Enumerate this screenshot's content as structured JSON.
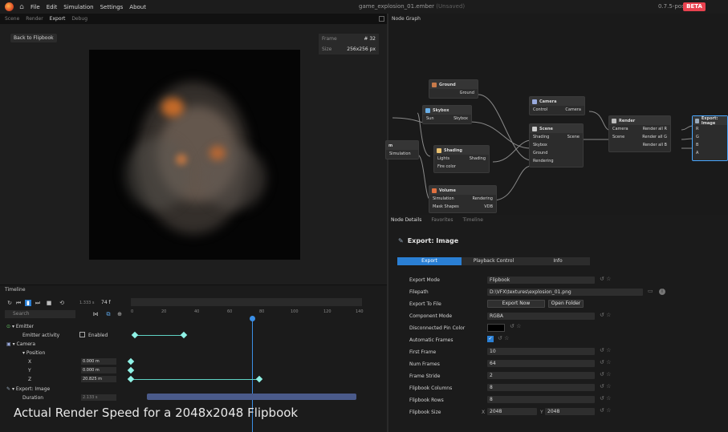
{
  "app": {
    "title": "game_explosion_01.ember",
    "title_sub": "(Unsaved)",
    "version": "0.7.5-post",
    "beta": "BETA",
    "menu": [
      "File",
      "Edit",
      "Simulation",
      "Settings",
      "About"
    ]
  },
  "viewport": {
    "tabs": [
      "Scene",
      "Render",
      "Export",
      "Debug"
    ],
    "active_tab": "Export",
    "back_button": "Back to Flipbook",
    "frame_label": "Frame",
    "frame_value": "# 32",
    "size_label": "Size",
    "size_value": "256x256 px"
  },
  "graph": {
    "label": "Node Graph",
    "nodes": [
      {
        "id": "ground",
        "title": "Ground",
        "rows": [
          [
            "",
            "Ground"
          ]
        ]
      },
      {
        "id": "skybox",
        "title": "Skybox",
        "rows": [
          [
            "Sun",
            "Skybox"
          ]
        ]
      },
      {
        "id": "shading",
        "title": "Shading",
        "rows": [
          [
            "Lights",
            "Shading"
          ],
          [
            "Fire color",
            ""
          ]
        ]
      },
      {
        "id": "volume",
        "title": "Volume",
        "rows": [
          [
            "Simulation",
            "Rendering"
          ],
          [
            "Mask Shapes",
            "VDB"
          ]
        ]
      },
      {
        "id": "camera",
        "title": "Camera",
        "rows": [
          [
            "Control",
            "Camera"
          ]
        ]
      },
      {
        "id": "scene",
        "title": "Scene",
        "rows": [
          [
            "Shading",
            "Scene"
          ],
          [
            "Skybox",
            ""
          ],
          [
            "Ground",
            ""
          ],
          [
            "Rendering",
            ""
          ]
        ]
      },
      {
        "id": "render",
        "title": "Render",
        "rows": [
          [
            "Camera",
            "Render all R"
          ],
          [
            "Scene",
            "Render all G"
          ],
          [
            "",
            "Render all B"
          ]
        ]
      },
      {
        "id": "export",
        "title": "Export: Image",
        "rows": [
          [
            "R",
            ""
          ],
          [
            "G",
            ""
          ],
          [
            "B",
            ""
          ],
          [
            "A",
            ""
          ]
        ]
      },
      {
        "id": "sim-partial",
        "title": "m",
        "rows": [
          [
            "Simulation",
            ""
          ]
        ]
      }
    ]
  },
  "details": {
    "tabs": [
      "Node Details",
      "Favorites",
      "Timeline"
    ],
    "active_tab": "Node Details",
    "title": "Export: Image",
    "sub_tabs": [
      "Export",
      "Playback Control",
      "Info"
    ],
    "active_sub_tab": "Export",
    "props": {
      "export_mode": {
        "label": "Export Mode",
        "value": "Flipbook"
      },
      "filepath": {
        "label": "Filepath",
        "value": "D:\\VFX\\textures\\explosion_01.png"
      },
      "export_to_file": {
        "label": "Export To File",
        "export_now": "Export Now",
        "open_folder": "Open Folder"
      },
      "component_mode": {
        "label": "Component Mode",
        "value": "RGBA"
      },
      "disconnected_pin_color": {
        "label": "Disconnected Pin Color",
        "color": "#000000"
      },
      "automatic_frames": {
        "label": "Automatic Frames",
        "checked": true
      },
      "first_frame": {
        "label": "First Frame",
        "value": "10"
      },
      "num_frames": {
        "label": "Num Frames",
        "value": "64"
      },
      "frame_stride": {
        "label": "Frame Stride",
        "value": "2"
      },
      "flipbook_columns": {
        "label": "Flipbook Columns",
        "value": "8"
      },
      "flipbook_rows": {
        "label": "Flipbook Rows",
        "value": "8"
      },
      "flipbook_size": {
        "label": "Flipbook Size",
        "x_label": "X",
        "x": "2048",
        "y_label": "Y",
        "y": "2048"
      }
    }
  },
  "timeline": {
    "label": "Timeline",
    "time_value": "1.333 s",
    "frame_value": "74 f",
    "search_placeholder": "Search",
    "ticks": [
      "0",
      "20",
      "40",
      "60",
      "80",
      "100",
      "120",
      "140"
    ],
    "tracks": {
      "emitter": "Emitter",
      "emitter_activity": "Emitter activity",
      "enabled": "Enabled",
      "camera": "Camera",
      "position": "Position",
      "x": "X",
      "x_val": "0.000 m",
      "y": "Y",
      "y_val": "0.000 m",
      "z": "Z",
      "z_val": "20.825 m",
      "export": "Export: Image",
      "duration": "Duration",
      "duration_val": "2.133 s"
    }
  },
  "caption": "Actual Render Speed for a 2048x2048 Flipbook"
}
